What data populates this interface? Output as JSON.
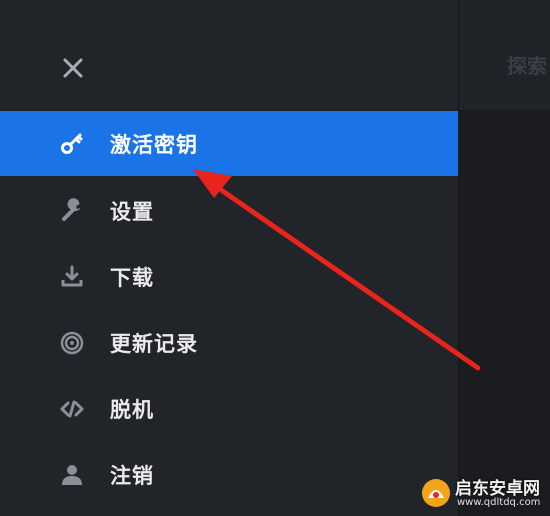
{
  "main": {
    "title": "探索"
  },
  "sidebar": {
    "close_icon": "close-icon",
    "items": [
      {
        "label": "激活密钥",
        "icon": "key-icon",
        "active": true
      },
      {
        "label": "设置",
        "icon": "wrench-icon",
        "active": false
      },
      {
        "label": "下载",
        "icon": "download-icon",
        "active": false
      },
      {
        "label": "更新记录",
        "icon": "changelog-icon",
        "active": false
      },
      {
        "label": "脱机",
        "icon": "offline-icon",
        "active": false
      },
      {
        "label": "注销",
        "icon": "user-icon",
        "active": false
      }
    ]
  },
  "annotation": {
    "color": "#e8241c"
  },
  "watermark": {
    "name": "启东安卓网",
    "url": "www.qdltdq.com"
  },
  "colors": {
    "accent": "#1a74e8",
    "sidebar_bg": "#212429",
    "main_bg": "#1a1c20",
    "icon_gray": "#8a8f98"
  }
}
